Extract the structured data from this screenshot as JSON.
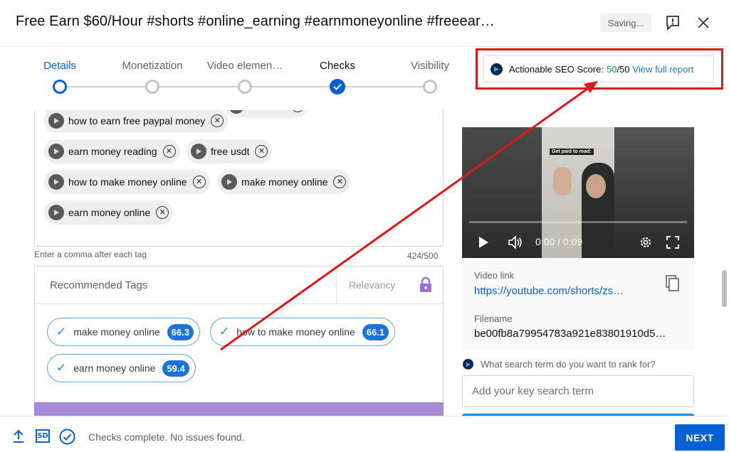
{
  "header": {
    "title": "Free Earn $60/Hour #shorts #online_earning #earnmoneyonline #freeear…",
    "saving_label": "Saving..."
  },
  "stepper": {
    "steps": [
      {
        "label": "Details",
        "state": "active"
      },
      {
        "label": "Monetization",
        "state": "pending"
      },
      {
        "label": "Video elemen…",
        "state": "pending"
      },
      {
        "label": "Checks",
        "state": "done"
      },
      {
        "label": "Visibility",
        "state": "pending"
      }
    ]
  },
  "seo": {
    "label": "Actionable SEO Score:",
    "score": "50",
    "max": "/50",
    "link": "View full report",
    "logo_text": "5D"
  },
  "tags": {
    "items": [
      "how to earn free paypal money",
      "earn money reading",
      "free usdt",
      "how to make money online",
      "make money online",
      "earn money online"
    ],
    "helper": "Enter a comma after each tag",
    "counter": "424/500"
  },
  "recommended": {
    "title": "Recommended Tags",
    "relevancy": "Relevancy",
    "items": [
      {
        "label": "make money online",
        "score": "66.3"
      },
      {
        "label": "how to make money online",
        "score": "66.1"
      },
      {
        "label": "earn money online",
        "score": "59.4"
      }
    ]
  },
  "video": {
    "caption": "Get paid to read:",
    "time": "0:00 / 0:09",
    "link_label": "Video link",
    "link": "https://youtube.com/shorts/zs…",
    "filename_label": "Filename",
    "filename": "be00fb8a79954783a921e83801910d5…"
  },
  "search": {
    "question": "What search term do you want to rank for?",
    "placeholder": "Add your key search term"
  },
  "footer": {
    "status": "Checks complete. No issues found.",
    "next_label": "NEXT",
    "sd_label": "SD"
  },
  "colors": {
    "accent": "#065fd4",
    "annotation": "#e01515",
    "score_green": "#1aa34a",
    "tag_score": "#1a73d9",
    "purple": "#a78bd8"
  }
}
